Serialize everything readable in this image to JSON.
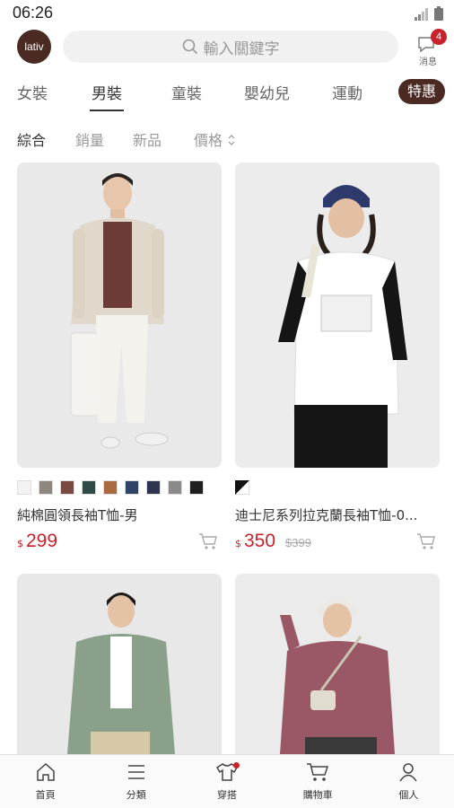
{
  "status_bar": {
    "time": "06:26"
  },
  "header": {
    "logo": "lativ",
    "search_placeholder": "輸入關鍵字",
    "messages_label": "消息",
    "messages_badge": "4"
  },
  "category_tabs": [
    {
      "label": "女裝"
    },
    {
      "label": "男裝",
      "active": true
    },
    {
      "label": "童裝"
    },
    {
      "label": "嬰幼兒"
    },
    {
      "label": "運動"
    },
    {
      "label": "特惠",
      "highlight": true
    }
  ],
  "sort_options": [
    {
      "label": "綜合",
      "active": true
    },
    {
      "label": "銷量"
    },
    {
      "label": "新品"
    },
    {
      "label": "價格"
    }
  ],
  "products": [
    {
      "name": "純棉圓領長袖T恤-男",
      "currency": "$",
      "price": "299",
      "swatches": [
        "#f3f3f3",
        "#8d877f",
        "#7a4a41",
        "#2f4a47",
        "#a86a3e",
        "#2e4366",
        "#2f3550",
        "#8a8a8a",
        "#1f1f1f"
      ]
    },
    {
      "name": "迪士尼系列拉克蘭長袖T恤-0...",
      "currency": "$",
      "price": "350",
      "old_price": "$399"
    },
    {
      "name": "",
      "price": ""
    },
    {
      "name": "",
      "price": ""
    }
  ],
  "bottom_nav": [
    {
      "label": "首頁",
      "icon": "home-icon"
    },
    {
      "label": "分類",
      "icon": "menu-icon"
    },
    {
      "label": "穿搭",
      "icon": "tshirt-icon",
      "dot": true
    },
    {
      "label": "購物車",
      "icon": "cart-icon"
    },
    {
      "label": "個人",
      "icon": "person-icon"
    }
  ]
}
